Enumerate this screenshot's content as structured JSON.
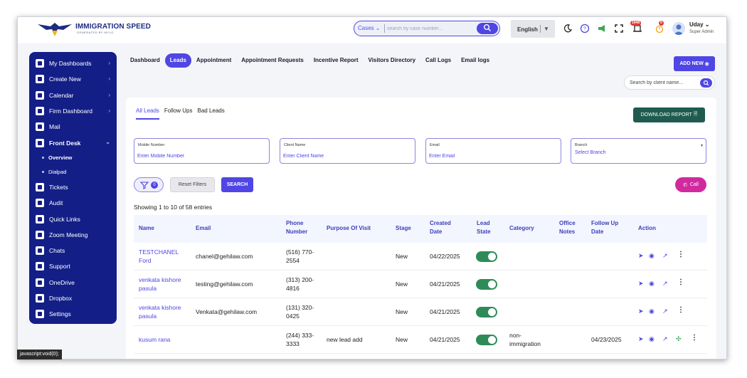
{
  "brand": {
    "name": "IMMIGRATION SPEED",
    "tagline": "GENERATED BY MYLO"
  },
  "topbar": {
    "search_category": "Cases",
    "search_placeholder": "search by case number...",
    "language": "English",
    "notification_count": "1948",
    "gift_count": "0",
    "user_name": "Uday",
    "user_role": "Super Admin"
  },
  "sidebar": {
    "items": [
      {
        "label": "My Dashboards",
        "chevron": true
      },
      {
        "label": "Create New",
        "chevron": true
      },
      {
        "label": "Calendar",
        "chevron": true
      },
      {
        "label": "Firm Dashboard",
        "chevron": true
      },
      {
        "label": "Mail",
        "chevron": false
      },
      {
        "label": "Front Desk",
        "chevron": true,
        "expanded": true
      },
      {
        "label": "Overview",
        "sub": true,
        "active": true
      },
      {
        "label": "Dialpad",
        "sub": true
      },
      {
        "label": "Tickets",
        "chevron": false
      },
      {
        "label": "Audit",
        "chevron": false
      },
      {
        "label": "Quick Links",
        "chevron": false
      },
      {
        "label": "Zoom Meeting",
        "chevron": false
      },
      {
        "label": "Chats",
        "chevron": false
      },
      {
        "label": "Support",
        "chevron": false
      },
      {
        "label": "OneDrive",
        "chevron": false
      },
      {
        "label": "Dropbox",
        "chevron": false
      },
      {
        "label": "Settings",
        "chevron": false
      }
    ]
  },
  "tabs": [
    "Dashboard",
    "Leads",
    "Appointment",
    "Appointment Requests",
    "Incentive Report",
    "Visitors Directory",
    "Call Logs",
    "Email logs"
  ],
  "active_tab": "Leads",
  "add_new_label": "ADD NEW",
  "client_search_placeholder": "Search by client name...",
  "subtabs": [
    "All Leads",
    "Follow Ups",
    "Bad Leads"
  ],
  "download_report_label": "DOWNLOAD REPORT",
  "filters": {
    "mobile": {
      "label": "Mobile Number",
      "placeholder": "Enter Mobile Number"
    },
    "client": {
      "label": "Client Name",
      "placeholder": "Enter Client Name"
    },
    "email": {
      "label": "Email",
      "placeholder": "Enter Email"
    },
    "branch": {
      "label": "Branch",
      "value": "Select Branch"
    }
  },
  "filter_count": "0",
  "reset_filters_label": "Reset Filters",
  "search_label": "SEARCH",
  "call_label": "Call",
  "showing_text": "Showing 1 to 10 of 58 entries",
  "table": {
    "headers": [
      "Name",
      "Email",
      "Phone Number",
      "Purpose Of Visit",
      "Stage",
      "Created Date",
      "Lead State",
      "Category",
      "Office Notes",
      "Follow Up Date",
      "Action"
    ],
    "rows": [
      {
        "name": "TESTCHANEL Ford",
        "email": "chanel@gehilaw.com",
        "phone": "(516) 770-2554",
        "purpose": "",
        "stage": "New",
        "created": "04/22/2025",
        "category": "",
        "notes": "",
        "followup": ""
      },
      {
        "name": "venkata kishore pasula",
        "email": "testing@gehilaw.com",
        "phone": "(313) 200-4816",
        "purpose": "",
        "stage": "New",
        "created": "04/21/2025",
        "category": "",
        "notes": "",
        "followup": ""
      },
      {
        "name": "venkata kishore pasula",
        "email": "Venkata@gehilaw.com",
        "phone": "(131) 320-0425",
        "purpose": "",
        "stage": "New",
        "created": "04/21/2025",
        "category": "",
        "notes": "",
        "followup": ""
      },
      {
        "name": "kusum rana",
        "email": "",
        "phone": "(244) 333-3333",
        "purpose": "new lead add",
        "stage": "New",
        "created": "04/21/2025",
        "category": "non-immigration",
        "notes": "",
        "followup": "04/23/2025"
      }
    ]
  },
  "status_bar": "javascript:void(0);"
}
